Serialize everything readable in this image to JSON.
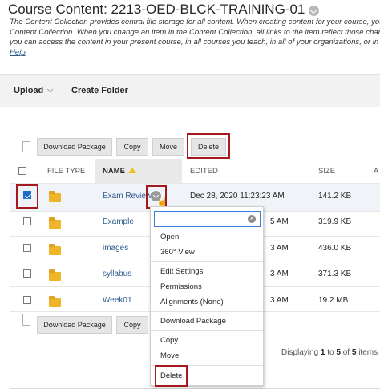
{
  "header": {
    "title": "Course Content: 2213-OED-BLCK-TRAINING-01",
    "description_lines": [
      "The Content Collection provides central file storage for all content. When creating content for your course, you c",
      "Content Collection. When you change an item in the Content Collection, all links to the item reflect those change",
      "you can access the content in your present course, in all courses you teach, in all of your organizations, or in al"
    ],
    "help_link": "Help"
  },
  "action_bar": {
    "upload": "Upload",
    "create_folder": "Create Folder"
  },
  "top_buttons": {
    "download_package": "Download Package",
    "copy": "Copy",
    "move": "Move",
    "delete": "Delete"
  },
  "bottom_buttons": {
    "download_package": "Download Package",
    "copy": "Copy"
  },
  "columns": {
    "file_type": "FILE TYPE",
    "name": "NAME",
    "edited": "EDITED",
    "size": "SIZE",
    "extra": "A"
  },
  "rows": [
    {
      "name": "Exam Review",
      "edited": "Dec 28, 2020 11:23:23 AM",
      "size": "141.2 KB",
      "checked": true
    },
    {
      "name": "Example",
      "edited": "5 AM",
      "size": "319.9 KB",
      "checked": false
    },
    {
      "name": "images",
      "edited": "3 AM",
      "size": "436.0 KB",
      "checked": false
    },
    {
      "name": "syllabus",
      "edited": "3 AM",
      "size": "371.3 KB",
      "checked": false
    },
    {
      "name": "Week01",
      "edited": "3 AM",
      "size": "19.2 MB",
      "checked": false
    }
  ],
  "dropdown": {
    "search_value": "",
    "clear_glyph": "×",
    "group1": [
      "Open",
      "360° View"
    ],
    "group2": [
      "Edit Settings",
      "Permissions",
      "Alignments (None)"
    ],
    "group3": [
      "Download Package"
    ],
    "group4": [
      "Copy",
      "Move"
    ],
    "group5": [
      "Delete"
    ]
  },
  "pager": {
    "prefix": "Displaying",
    "from": "1",
    "to_word": "to",
    "to": "5",
    "of_word": "of",
    "total": "5",
    "suffix": "items"
  },
  "colors": {
    "highlight": "#a3191e",
    "link": "#2d5a8c",
    "checkbox_checked": "#1f6fc9",
    "sort_arrow": "#f0c020"
  }
}
